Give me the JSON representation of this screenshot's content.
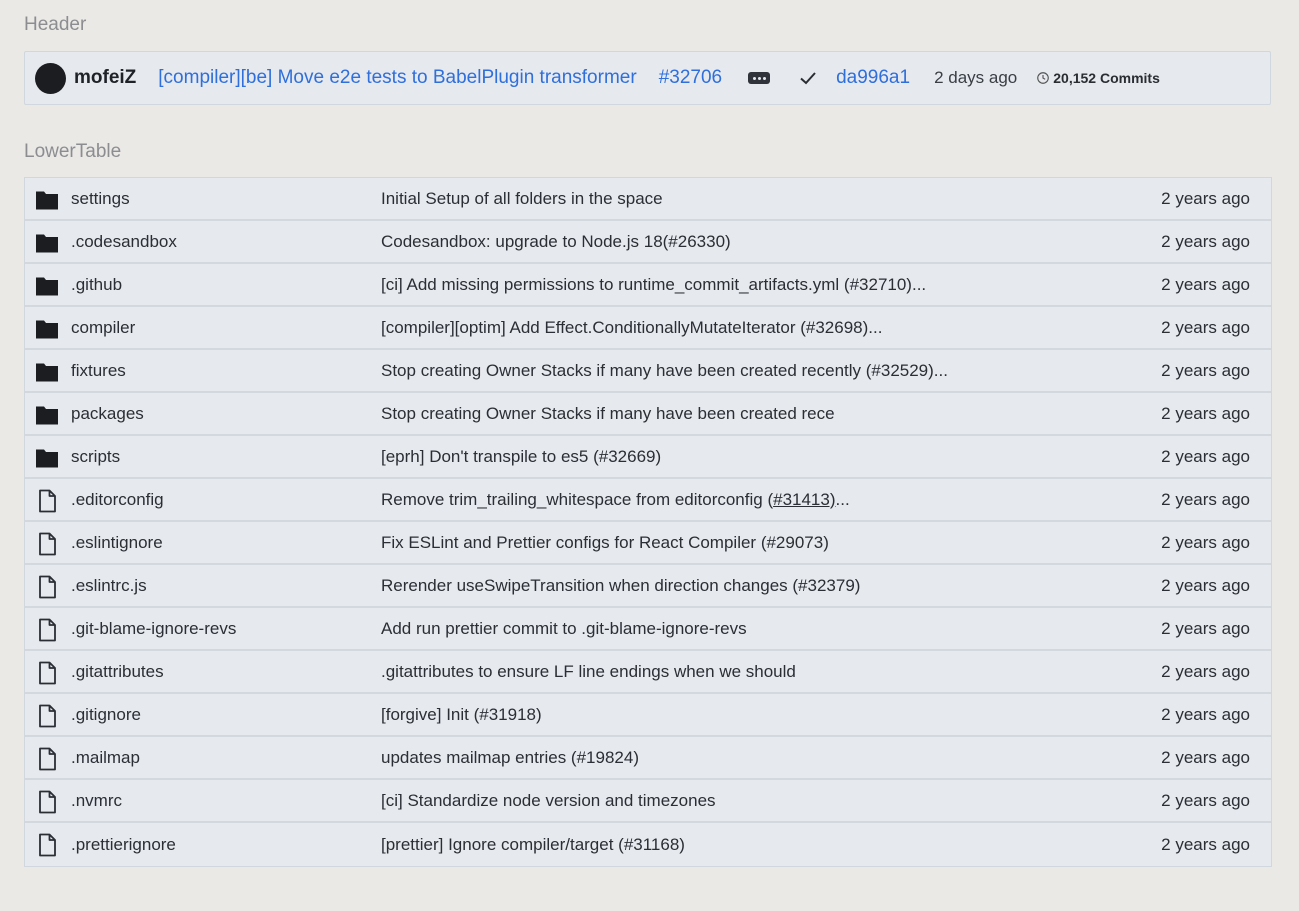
{
  "sections": {
    "header": "Header",
    "lower_table": "LowerTable"
  },
  "header": {
    "author": "mofeiZ",
    "commit_message": "[compiler][be] Move e2e tests to BabelPlugin transformer",
    "pr_number": "#32706",
    "commit_sha": "da996a1",
    "time_ago": "2 days ago",
    "commits_count": "20,152 Commits"
  },
  "rows": [
    {
      "type": "folder",
      "name": "settings",
      "message": "Initial Setup of all folders in the space",
      "age": "2 years ago"
    },
    {
      "type": "folder",
      "name": ".codesandbox",
      "message": " Codesandbox: upgrade to Node.js 18(#26330)",
      "age": "2 years ago"
    },
    {
      "type": "folder",
      "name": ".github",
      "message": "[ci] Add missing permissions to runtime_commit_artifacts.yml (#32710)...",
      "age": "2 years ago"
    },
    {
      "type": "folder",
      "name": "compiler",
      "message": "[compiler][optim] Add Effect.ConditionallyMutateIterator (#32698)...",
      "age": "2 years ago"
    },
    {
      "type": "folder",
      "name": "fixtures",
      "message": "Stop creating Owner Stacks if many have been created recently (#32529)...",
      "age": "2 years ago"
    },
    {
      "type": "folder",
      "name": "packages",
      "message": "Stop creating Owner Stacks if many have been created rece",
      "age": "2 years ago"
    },
    {
      "type": "folder",
      "name": "scripts",
      "message": "[eprh] Don't transpile to es5 (#32669)",
      "age": "2 years ago"
    },
    {
      "type": "file",
      "name": ".editorconfig",
      "message_parts": [
        "Remove trim_trailing_whitespace from editorconfig (",
        "#31413)",
        "..."
      ],
      "age": "2 years ago"
    },
    {
      "type": "file",
      "name": ".eslintignore",
      "message": "Fix ESLint and Prettier configs for React Compiler (#29073)",
      "age": "2 years ago"
    },
    {
      "type": "file",
      "name": ".eslintrc.js",
      "message": "Rerender useSwipeTransition when direction changes (#32379)",
      "age": "2 years ago"
    },
    {
      "type": "file",
      "name": ".git-blame-ignore-revs",
      "message": "Add run prettier commit to .git-blame-ignore-revs",
      "age": "2 years ago"
    },
    {
      "type": "file",
      "name": ".gitattributes",
      "message": " .gitattributes to ensure LF line endings when we should",
      "age": "2 years ago"
    },
    {
      "type": "file",
      "name": ".gitignore",
      "message": "[forgive] Init (#31918)",
      "age": "2 years ago"
    },
    {
      "type": "file",
      "name": ".mailmap",
      "message": "updates mailmap entries (#19824)",
      "age": "2 years ago"
    },
    {
      "type": "file",
      "name": ".nvmrc",
      "message": "[ci] Standardize node version and timezones",
      "age": "2 years ago"
    },
    {
      "type": "file",
      "name": ".prettierignore",
      "message": "[prettier] Ignore compiler/target (#31168)",
      "age": "2 years ago"
    }
  ],
  "icons": {
    "folder": "folder-icon",
    "file": "file-icon",
    "check": "check-icon",
    "history": "history-icon",
    "more": "ellipsis-icon"
  }
}
